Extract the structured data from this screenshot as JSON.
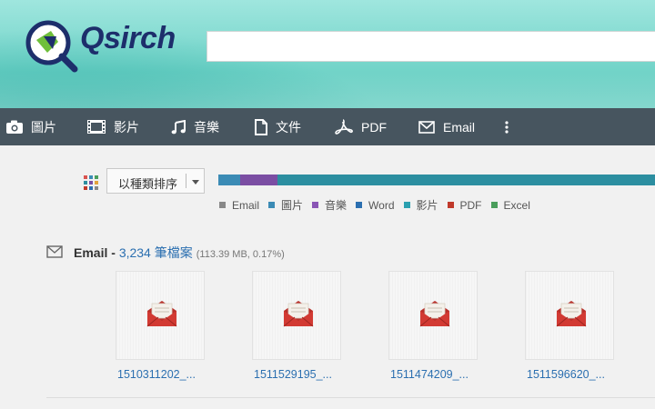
{
  "app": {
    "logo_text": "Qsirch",
    "search": {
      "value": "",
      "placeholder": ""
    }
  },
  "toolbar": {
    "items": [
      {
        "label": "圖片",
        "icon": "camera-icon"
      },
      {
        "label": "影片",
        "icon": "film-icon"
      },
      {
        "label": "音樂",
        "icon": "music-icon"
      },
      {
        "label": "文件",
        "icon": "document-icon"
      },
      {
        "label": "PDF",
        "icon": "pdf-icon"
      },
      {
        "label": "Email",
        "icon": "email-icon"
      },
      {
        "label": "",
        "icon": "more-vertical-icon"
      }
    ]
  },
  "sort": {
    "selected": "以種類排序"
  },
  "distribution": {
    "segments": [
      {
        "name": "Email",
        "share": 0.05,
        "color": "#3b8bb5"
      },
      {
        "name": "音樂",
        "share": 0.085,
        "color": "#7b4ea3"
      },
      {
        "name": "影片",
        "share": 0.865,
        "color": "#2c8ea0"
      }
    ],
    "legend": [
      {
        "label": "Email",
        "color": "#888888"
      },
      {
        "label": "圖片",
        "color": "#3b8bb5"
      },
      {
        "label": "音樂",
        "color": "#8a55b5"
      },
      {
        "label": "Word",
        "color": "#2b6fb0"
      },
      {
        "label": "影片",
        "color": "#2ba0b0"
      },
      {
        "label": "PDF",
        "color": "#c0392b"
      },
      {
        "label": "Excel",
        "color": "#4a9e5c"
      }
    ]
  },
  "section": {
    "category": "Email",
    "separator": " - ",
    "count": "3,234 筆檔案",
    "meta": "(113.39 MB, 0.17%)",
    "files": [
      {
        "name": "1510311202_..."
      },
      {
        "name": "1511529195_..."
      },
      {
        "name": "1511474209_..."
      },
      {
        "name": "1511596620_..."
      }
    ]
  }
}
